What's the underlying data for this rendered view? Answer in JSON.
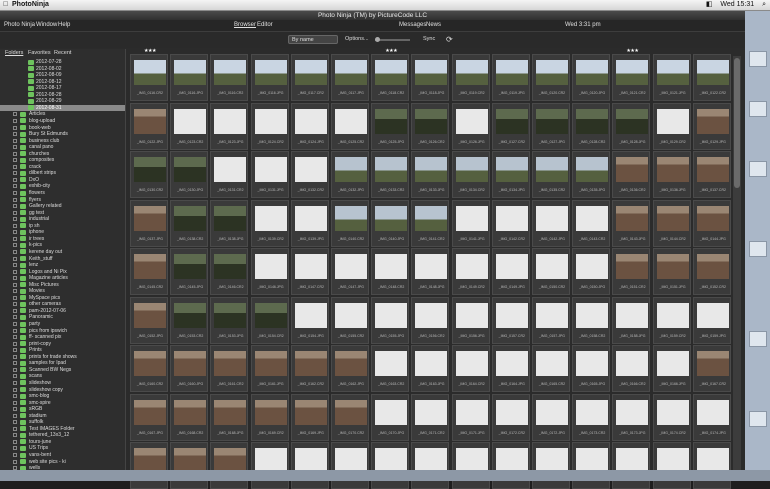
{
  "macbar": {
    "app_name": "PhotoNinja",
    "clock": "Wed 15:31",
    "battery": "◧",
    "search_glyph": "⌕"
  },
  "window": {
    "title": "Photo Ninja (TM) by PictureCode LLC",
    "menus": {
      "app": "Photo Ninja",
      "window": "Window",
      "help": "Help",
      "browser": "Browser",
      "editor": "Editor",
      "messages": "Messages",
      "news": "News",
      "time": "Wed 3:31 pm"
    }
  },
  "toolbar": {
    "sort": "By name",
    "options": "Options...",
    "sync": "Sync",
    "refresh_glyph": "⟳"
  },
  "left_panel": {
    "tabs": [
      "Folders",
      "Favorites",
      "Recent"
    ],
    "tree_dated": [
      "2012-07-28",
      "2012-08-02",
      "2012-08-09",
      "2012-08-12",
      "2012-08-17",
      "2012-08-28",
      "2012-08-29"
    ],
    "tree_selected": "2012-08-31",
    "tree_folders": [
      "Articles",
      "blog-upload",
      "book-web",
      "Bury St Edmunds",
      "business club",
      "canal pano",
      "churches",
      "composites",
      "crack",
      "dilbert strips",
      "DxO",
      "exhib-city",
      "flowers",
      "flyers",
      "Gallery related",
      "gg test",
      "industrial",
      "ip sh",
      "iphone",
      "ir trees",
      "k-pics",
      "kerene day out",
      "Keith_stuff",
      "lenz",
      "Logos and Ni Pix",
      "Magazine articles",
      "Misc Pictures",
      "Movies",
      "MySpace pics",
      "other cameras",
      "pam-2012-07-06",
      "Panoramic",
      "party",
      "pics from ipswich",
      "ff- scanned pix",
      "print-copy",
      "Prints",
      "prints for trade shows",
      "samples for Ipad",
      "Scanned BW Negs",
      "scans",
      "slideshow",
      "slideshow copy",
      "smc-blog",
      "smc-spire",
      "sRGB",
      "stadium",
      "suffolk",
      "Test IMAGES Folder",
      "tethered_13x3_12",
      "tours-june",
      "US Trips",
      "vans-bent",
      "web site pics - ki",
      "wells"
    ]
  },
  "thumbnails": {
    "rows": [
      {
        "captions": [
          "_IMG_0116.CR2",
          "_IMG_0116.JPG",
          "_IMG_0116.CR2",
          "_IMG_0116.JPG",
          "_IMG_0117.CR2",
          "_IMG_0117.JPG",
          "_IMG_0118.CR2",
          "_IMG_0118.JPG",
          "_IMG_0119.CR2",
          "_IMG_0119.JPG",
          "_IMG_0120.CR2",
          "_IMG_0120.JPG",
          "_IMG_0121.CR2",
          "_IMG_0121.JPG",
          "_IMG_0122.CR2"
        ],
        "tones": [
          "sky",
          "sky",
          "sky",
          "sky",
          "sky",
          "sky",
          "sky",
          "sky",
          "sky",
          "sky",
          "sky",
          "sky",
          "sky",
          "sky",
          "sky"
        ],
        "stars": [
          "★★★",
          "",
          "",
          "",
          "",
          "",
          "★★★",
          "",
          "",
          "",
          "",
          "",
          "★★★",
          "",
          ""
        ]
      },
      {
        "captions": [
          "_IMG_0122.JPG",
          "_IMG_0123.CR2",
          "_IMG_0123.JPG",
          "_IMG_0124.CR2",
          "_IMG_0124.JPG",
          "_IMG_0125.CR2",
          "_IMG_0125.JPG",
          "_IMG_0126.CR2",
          "_IMG_0126.JPG",
          "_IMG_0127.CR2",
          "_IMG_0127.JPG",
          "_IMG_0128.CR2",
          "_IMG_0128.JPG",
          "_IMG_0129.CR2",
          "_IMG_0129.JPG"
        ],
        "tones": [
          "brick",
          "white",
          "white",
          "white",
          "white",
          "white",
          "dark",
          "dark",
          "white",
          "dark",
          "dark",
          "dark",
          "dark",
          "white",
          "brick"
        ],
        "stars": []
      },
      {
        "captions": [
          "_IMG_0130.CR2",
          "_IMG_0130.JPG",
          "_IMG_0131.CR2",
          "_IMG_0131.JPG",
          "_IMG_0132.CR2",
          "_IMG_0132.JPG",
          "_IMG_0133.CR2",
          "_IMG_0133.JPG",
          "_IMG_0134.CR2",
          "_IMG_0134.JPG",
          "_IMG_0135.CR2",
          "_IMG_0135.JPG",
          "_IMG_0136.CR2",
          "_IMG_0136.JPG",
          "_IMG_0137.CR2"
        ],
        "tones": [
          "dark",
          "dark",
          "white",
          "white",
          "white",
          "spire",
          "spire",
          "spire",
          "spire",
          "spire",
          "spire",
          "spire",
          "brick",
          "brick",
          "brick"
        ],
        "stars": []
      },
      {
        "captions": [
          "_IMG_0137.JPG",
          "_IMG_0138.CR2",
          "_IMG_0138.JPG",
          "_IMG_0139.CR2",
          "_IMG_0139.JPG",
          "_IMG_0140.CR2",
          "_IMG_0140.JPG",
          "_IMG_0141.CR2",
          "_IMG_0141.JPG",
          "_IMG_0142.CR2",
          "_IMG_0142.JPG",
          "_IMG_0143.CR2",
          "_IMG_0143.JPG",
          "_IMG_0144.CR2",
          "_IMG_0144.JPG"
        ],
        "tones": [
          "brick",
          "dark",
          "dark",
          "white",
          "white",
          "spire",
          "spire",
          "spire",
          "white",
          "white",
          "white",
          "white",
          "brick",
          "brick",
          "brick"
        ],
        "stars": []
      },
      {
        "captions": [
          "_IMG_0145.CR2",
          "_IMG_0145.JPG",
          "_IMG_0146.CR2",
          "_IMG_0146.JPG",
          "_IMG_0147.CR2",
          "_IMG_0147.JPG",
          "_IMG_0148.CR2",
          "_IMG_0148.JPG",
          "_IMG_0149.CR2",
          "_IMG_0149.JPG",
          "_IMG_0150.CR2",
          "_IMG_0150.JPG",
          "_IMG_0151.CR2",
          "_IMG_0151.JPG",
          "_IMG_0152.CR2"
        ],
        "tones": [
          "brick",
          "dark",
          "dark",
          "white",
          "white",
          "white",
          "white",
          "white",
          "white",
          "white",
          "white",
          "white",
          "brick",
          "brick",
          "brick"
        ],
        "stars": []
      },
      {
        "captions": [
          "_IMG_0152.JPG",
          "_IMG_0153.CR2",
          "_IMG_0153.JPG",
          "_IMG_0154.CR2",
          "_IMG_0154.JPG",
          "_IMG_0155.CR2",
          "_IMG_0155.JPG",
          "_IMG_0156.CR2",
          "_IMG_0156.JPG",
          "_IMG_0157.CR2",
          "_IMG_0157.JPG",
          "_IMG_0158.CR2",
          "_IMG_0158.JPG",
          "_IMG_0159.CR2",
          "_IMG_0159.JPG"
        ],
        "tones": [
          "brick",
          "dark",
          "dark",
          "dark",
          "white",
          "white",
          "white",
          "white",
          "white",
          "white",
          "white",
          "white",
          "white",
          "white",
          "white"
        ],
        "stars": []
      },
      {
        "captions": [
          "_IMG_0160.CR2",
          "_IMG_0160.JPG",
          "_IMG_0161.CR2",
          "_IMG_0161.JPG",
          "_IMG_0162.CR2",
          "_IMG_0162.JPG",
          "_IMG_0163.CR2",
          "_IMG_0163.JPG",
          "_IMG_0164.CR2",
          "_IMG_0164.JPG",
          "_IMG_0165.CR2",
          "_IMG_0165.JPG",
          "_IMG_0166.CR2",
          "_IMG_0166.JPG",
          "_IMG_0167.CR2"
        ],
        "tones": [
          "brick",
          "brick",
          "brick",
          "brick",
          "brick",
          "brick",
          "white",
          "white",
          "white",
          "white",
          "white",
          "white",
          "white",
          "white",
          "brick"
        ],
        "stars": []
      },
      {
        "captions": [
          "_IMG_0167.JPG",
          "_IMG_0168.CR2",
          "_IMG_0168.JPG",
          "_IMG_0169.CR2",
          "_IMG_0169.JPG",
          "_IMG_0170.CR2",
          "_IMG_0170.JPG",
          "_IMG_0171.CR2",
          "_IMG_0171.JPG",
          "_IMG_0172.CR2",
          "_IMG_0172.JPG",
          "_IMG_0173.CR2",
          "_IMG_0173.JPG",
          "_IMG_0174.CR2",
          "_IMG_0174.JPG"
        ],
        "tones": [
          "brick",
          "brick",
          "brick",
          "brick",
          "brick",
          "brick",
          "white",
          "white",
          "white",
          "white",
          "white",
          "white",
          "white",
          "white",
          "white"
        ],
        "stars": []
      },
      {
        "captions": [
          "",
          "",
          "",
          "",
          "",
          "",
          "",
          "",
          "",
          "",
          "",
          "",
          "",
          "",
          ""
        ],
        "tones": [
          "brick",
          "brick",
          "brick",
          "white",
          "white",
          "white",
          "white",
          "white",
          "white",
          "white",
          "white",
          "white",
          "white",
          "white",
          "white"
        ],
        "stars": []
      }
    ]
  },
  "colors": {
    "sky": "#c9d5e2",
    "white": "#e8e8e8",
    "dark": "#2c3323",
    "brick": "#6b5241",
    "spire": "#b7c3cf"
  }
}
